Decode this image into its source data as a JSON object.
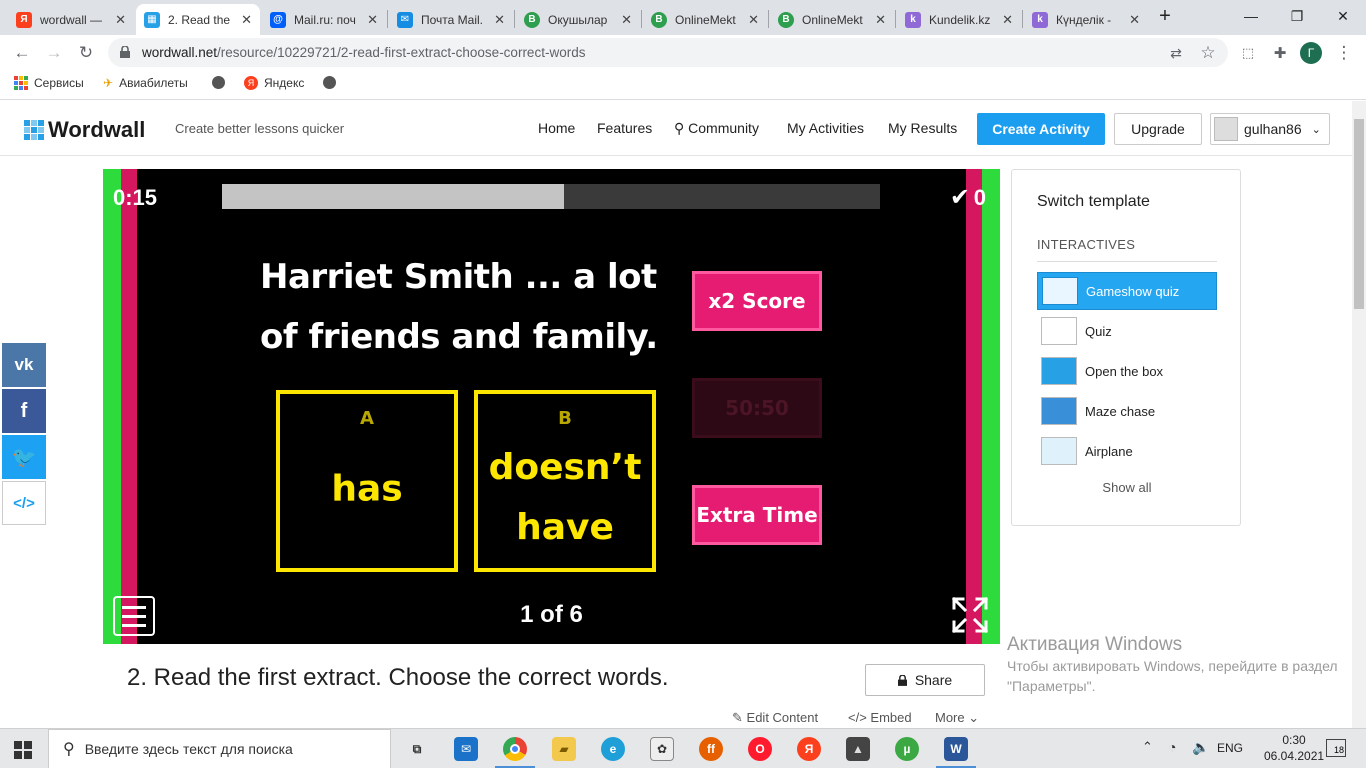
{
  "browser": {
    "tabs": [
      {
        "label": "wordwall — ",
        "icon": "yandex",
        "color": "#fc3f1d",
        "active": false
      },
      {
        "label": "2. Read the",
        "icon": "wordwall",
        "color": "#28a0e6",
        "active": true
      },
      {
        "label": "Mail.ru: поч",
        "icon": "mailru",
        "color": "#005ff9",
        "active": false
      },
      {
        "label": "Почта Mail.",
        "icon": "mail",
        "color": "#168de2",
        "active": false
      },
      {
        "label": "Окушылар",
        "icon": "onlinemektep",
        "color": "#2e9e4f",
        "active": false
      },
      {
        "label": "OnlineMekt",
        "icon": "onlinemektep",
        "color": "#2e9e4f",
        "active": false
      },
      {
        "label": "OnlineMekt",
        "icon": "onlinemektep",
        "color": "#2e9e4f",
        "active": false
      },
      {
        "label": "Kundelik.kz",
        "icon": "kundelik",
        "color": "#8f6ad6",
        "active": false
      },
      {
        "label": "Күнделік - ",
        "icon": "kundelik",
        "color": "#8f6ad6",
        "active": false
      }
    ],
    "url_host": "wordwall.net",
    "url_path": "/resource/10229721/2-read-first-extract-choose-correct-words",
    "bookmarks": [
      "Сервисы",
      "Авиабилеты",
      "",
      "Яндекс",
      ""
    ],
    "profile_initial": "Г"
  },
  "site": {
    "logo": "Wordwall",
    "tagline": "Create better lessons quicker",
    "nav": [
      "Home",
      "Features",
      "Community",
      "My Activities",
      "My Results"
    ],
    "create_label": "Create Activity",
    "upgrade_label": "Upgrade",
    "username": "gulhan86"
  },
  "game": {
    "timer": "0:15",
    "progress": 0.52,
    "score": "0",
    "question": "Harriet Smith ... a lot of friends and family.",
    "answers": [
      {
        "letter": "A",
        "text": "has"
      },
      {
        "letter": "B",
        "text": "doesn’t have"
      }
    ],
    "powerups": [
      {
        "label": "x2 Score",
        "enabled": true
      },
      {
        "label": "50:50",
        "enabled": false
      },
      {
        "label": "Extra Time",
        "enabled": true
      }
    ],
    "page": "1 of 6"
  },
  "activity": {
    "title": "2. Read the first extract. Choose the correct words.",
    "share_label": "Share",
    "edit_label": "Edit Content",
    "embed_label": "Embed",
    "more_label": "More"
  },
  "templates": {
    "switch_title": "Switch template",
    "section": "INTERACTIVES",
    "items": [
      "Gameshow quiz",
      "Quiz",
      "Open the box",
      "Maze chase",
      "Airplane"
    ],
    "show_all": "Show all"
  },
  "social": [
    "vk",
    "f",
    "twitter",
    "embed"
  ],
  "windows": {
    "activation_title": "Активация Windows",
    "activation_text": "Чтобы активировать Windows, перейдите в раздел \"Параметры\".",
    "search_placeholder": "Введите здесь текст для поиска",
    "lang": "ENG",
    "time": "0:30",
    "date": "06.04.2021",
    "notifications": "18"
  },
  "colors": {
    "accent": "#1b9ef0",
    "green_stripe": "#2ddb3c",
    "pink_stripe": "#d4175f",
    "answer_yellow": "#fde600"
  }
}
